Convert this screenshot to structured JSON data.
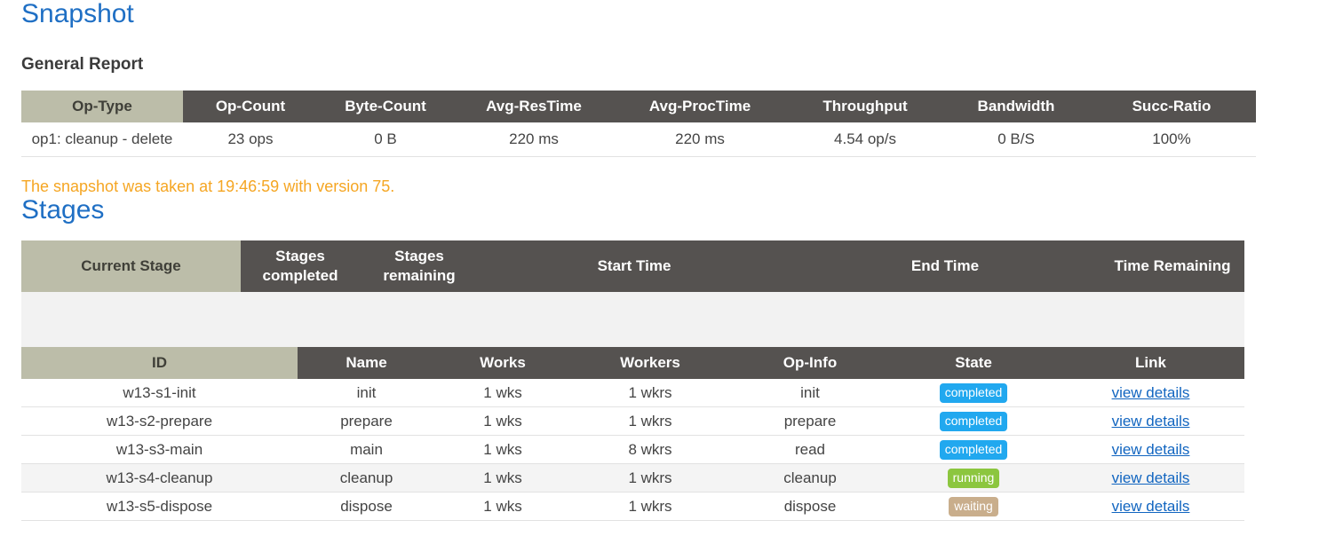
{
  "snapshot": {
    "title": "Snapshot",
    "subtitle": "General Report",
    "note": "The snapshot was taken at 19:46:59 with version 75.",
    "general_report": {
      "columns": [
        "Op-Type",
        "Op-Count",
        "Byte-Count",
        "Avg-ResTime",
        "Avg-ProcTime",
        "Throughput",
        "Bandwidth",
        "Succ-Ratio"
      ],
      "rows": [
        {
          "op_type": "op1: cleanup - delete",
          "op_count": "23 ops",
          "byte_count": "0 B",
          "avg_restime": "220 ms",
          "avg_proctime": "220 ms",
          "throughput": "4.54 op/s",
          "bandwidth": "0 B/S",
          "succ_ratio": "100%"
        }
      ]
    }
  },
  "stages": {
    "title": "Stages",
    "summary": {
      "columns": [
        "Current Stage",
        "Stages completed",
        "Stages remaining",
        "Start Time",
        "End Time",
        "Time Remaining"
      ],
      "rows": [
        {
          "current_stage": "",
          "stages_completed": "",
          "stages_remaining": "",
          "start_time": "",
          "end_time": "",
          "time_remaining": ""
        }
      ]
    },
    "list": {
      "columns": [
        "ID",
        "Name",
        "Works",
        "Workers",
        "Op-Info",
        "State",
        "Link"
      ],
      "rows": [
        {
          "id": "w13-s1-init",
          "name": "init",
          "works": "1 wks",
          "workers": "1 wkrs",
          "op_info": "init",
          "state": "completed",
          "state_kind": "completed",
          "link": "view details",
          "highlight": false
        },
        {
          "id": "w13-s2-prepare",
          "name": "prepare",
          "works": "1 wks",
          "workers": "1 wkrs",
          "op_info": "prepare",
          "state": "completed",
          "state_kind": "completed",
          "link": "view details",
          "highlight": false
        },
        {
          "id": "w13-s3-main",
          "name": "main",
          "works": "1 wks",
          "workers": "8 wkrs",
          "op_info": "read",
          "state": "completed",
          "state_kind": "completed",
          "link": "view details",
          "highlight": false
        },
        {
          "id": "w13-s4-cleanup",
          "name": "cleanup",
          "works": "1 wks",
          "workers": "1 wkrs",
          "op_info": "cleanup",
          "state": "running",
          "state_kind": "running",
          "link": "view details",
          "highlight": true
        },
        {
          "id": "w13-s5-dispose",
          "name": "dispose",
          "works": "1 wks",
          "workers": "1 wkrs",
          "op_info": "dispose",
          "state": "waiting",
          "state_kind": "waiting",
          "link": "view details",
          "highlight": false
        }
      ]
    }
  },
  "colors": {
    "heading_blue": "#1f6fc4",
    "header_dark": "#555250",
    "header_khaki": "#bcbda9",
    "note_orange": "#f5a623",
    "badge_completed": "#21a8ef",
    "badge_running": "#8cc63f",
    "badge_waiting": "#c9ae8c",
    "link_blue": "#1165c0",
    "row_highlight": "#f4f4f4"
  }
}
